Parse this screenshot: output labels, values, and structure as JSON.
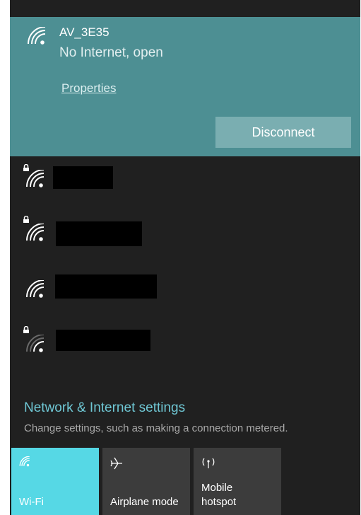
{
  "connected_network": {
    "ssid": "AV_3E35",
    "status": "No Internet, open",
    "properties_link": "Properties",
    "disconnect_label": "Disconnect",
    "icon": "wifi-full-icon"
  },
  "networks": [
    {
      "name": "",
      "secured": true,
      "icon": "wifi-secured-icon"
    },
    {
      "name": "",
      "secured": true,
      "icon": "wifi-secured-icon"
    },
    {
      "name": "",
      "secured": false,
      "icon": "wifi-open-icon"
    },
    {
      "name": "",
      "secured": true,
      "icon": "wifi-secured-weak-icon"
    }
  ],
  "settings": {
    "title": "Network & Internet settings",
    "description": "Change settings, such as making a connection metered."
  },
  "quick_actions": [
    {
      "label": "Wi-Fi",
      "active": true,
      "icon": "wifi-icon"
    },
    {
      "label": "Airplane mode",
      "active": false,
      "icon": "airplane-icon"
    },
    {
      "label_line1": "Mobile",
      "label_line2": "hotspot",
      "active": false,
      "icon": "hotspot-icon"
    }
  ],
  "colors": {
    "connected_bg": "#4d8f93",
    "flyout_bg": "#202020",
    "accent": "#6fc7d4",
    "active_tile": "#56d8e5",
    "tile": "#3c3c3c"
  }
}
